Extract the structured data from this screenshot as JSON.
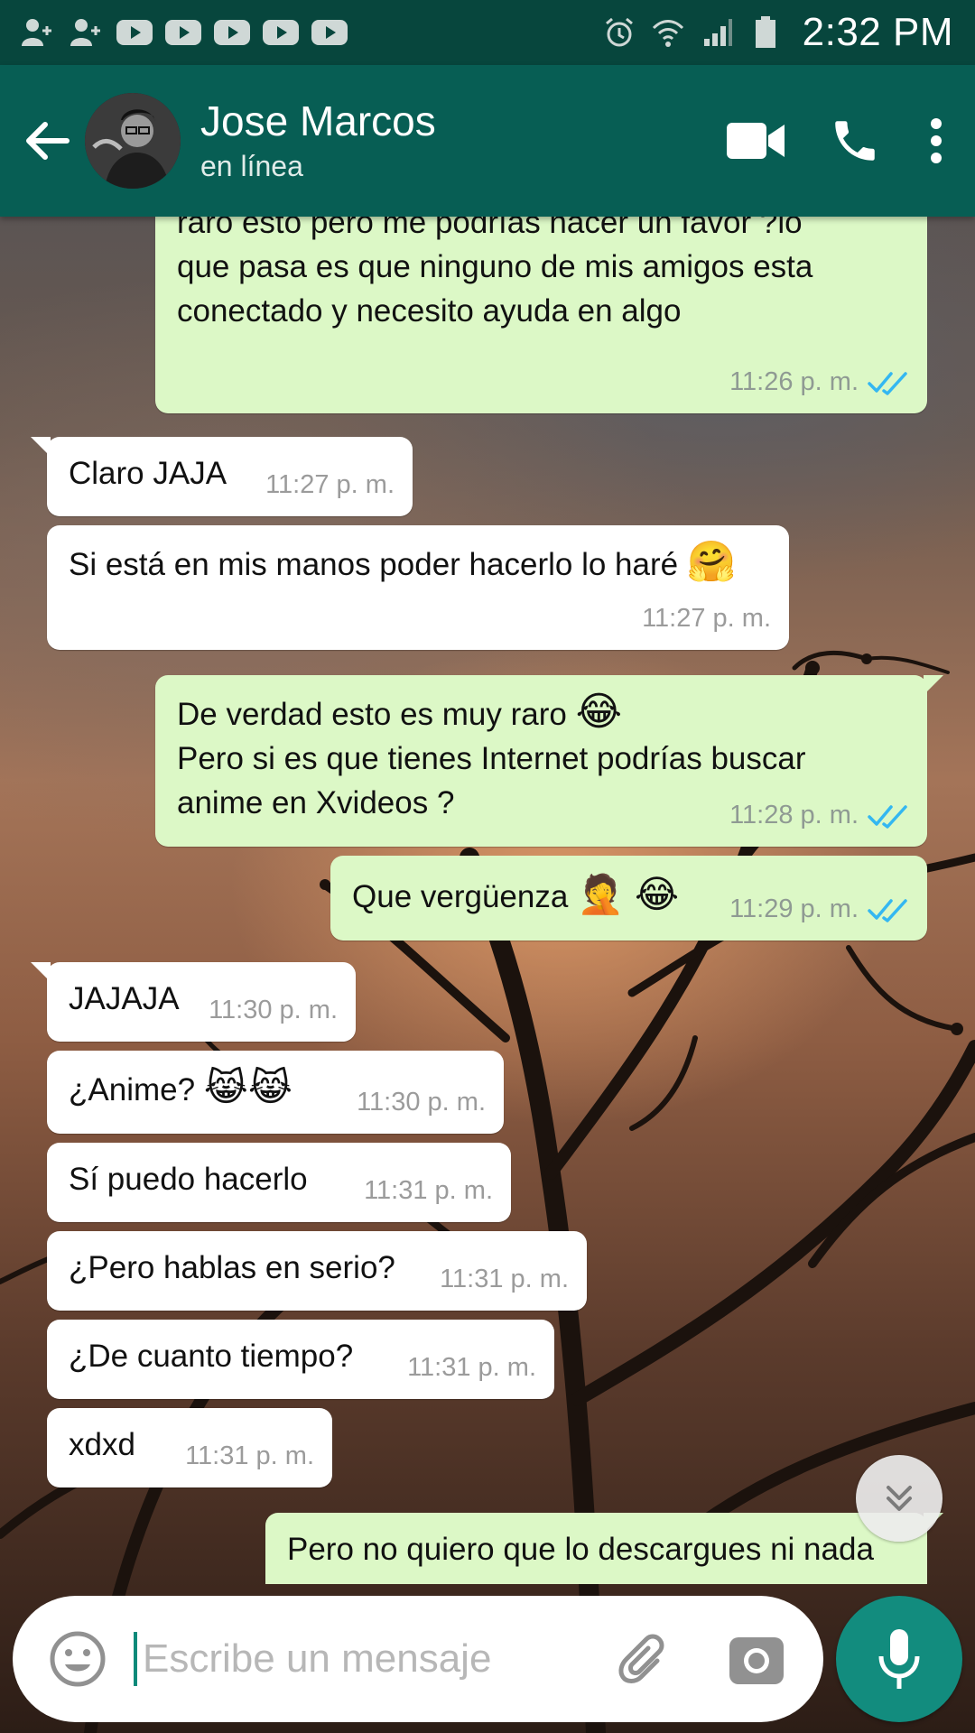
{
  "status_bar": {
    "time": "2:32 PM",
    "left_icons": [
      "add-user-icon",
      "add-user-icon",
      "youtube-icon",
      "youtube-icon",
      "youtube-icon",
      "youtube-icon",
      "youtube-icon"
    ],
    "right_icons": [
      "alarm-icon",
      "wifi-icon",
      "signal-icon",
      "battery-icon"
    ]
  },
  "header": {
    "contact_name": "Jose Marcos",
    "contact_status": "en línea"
  },
  "messages": [
    {
      "dir": "out",
      "text": "raro esto pero me podrías hacer un favor ?lo\nque pasa es que ninguno de mis amigos esta\nconectado y necesito ayuda en algo",
      "time": "11:26 p. m.",
      "read": true
    },
    {
      "dir": "in",
      "text": "Claro JAJA",
      "time": "11:27 p. m."
    },
    {
      "dir": "in",
      "text": "Si está en mis manos poder hacerlo lo haré",
      "emoji": "🤗",
      "time": "11:27 p. m."
    },
    {
      "dir": "out",
      "text_line1": "De verdad esto es muy raro",
      "emoji": "😂",
      "text": "Pero si es que tienes Internet podrías buscar\nanime en Xvideos ?",
      "time": "11:28 p. m.",
      "read": true
    },
    {
      "dir": "out",
      "text": "Que vergüenza",
      "emoji": "🤦 😂",
      "time": "11:29 p. m.",
      "read": true
    },
    {
      "dir": "in",
      "text": "JAJAJA",
      "time": "11:30 p. m."
    },
    {
      "dir": "in",
      "text": "¿Anime?",
      "emoji": "😹😹",
      "time": "11:30 p. m."
    },
    {
      "dir": "in",
      "text": "Sí puedo hacerlo",
      "time": "11:31 p. m."
    },
    {
      "dir": "in",
      "text": "¿Pero hablas en serio?",
      "time": "11:31 p. m."
    },
    {
      "dir": "in",
      "text": "¿De cuanto tiempo?",
      "time": "11:31 p. m."
    },
    {
      "dir": "in",
      "text": "xdxd",
      "time": "11:31 p. m."
    },
    {
      "dir": "out",
      "text": "Pero no quiero que lo descargues ni nada",
      "read": true
    }
  ],
  "input": {
    "placeholder": "Escribe un mensaje"
  },
  "colors": {
    "header": "#075e54",
    "status_bar": "#07463d",
    "outgoing_bubble": "#dcf8c6",
    "incoming_bubble": "#ffffff",
    "read_tick": "#34b7f1",
    "fab": "#128c7e"
  }
}
